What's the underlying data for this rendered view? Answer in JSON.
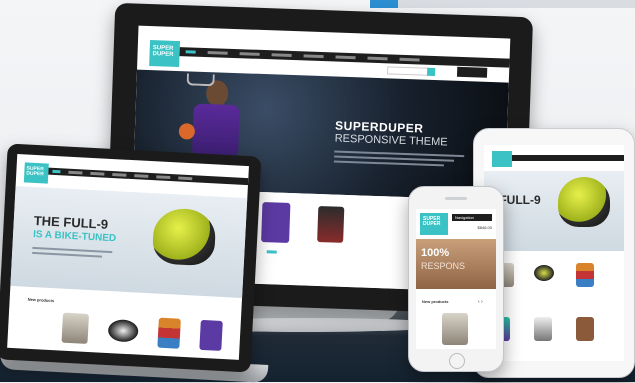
{
  "monitor": {
    "logo": [
      "SUPER",
      "DUPER"
    ],
    "headline": "SUPERDUPER",
    "subhead": "RESPONSIVE THEME"
  },
  "laptop": {
    "logo": [
      "SUPER",
      "DUPER"
    ],
    "headline": "THE FULL-9",
    "subhead": "IS A BIKE-TUNED",
    "section_title": "New products"
  },
  "tablet": {
    "headline": "E FULL-9"
  },
  "phone": {
    "logo": [
      "SUPER",
      "DUPER"
    ],
    "nav_label": "Navigation",
    "cart_amount": "$846.00",
    "headline": "100%",
    "subhead": "RESPONS",
    "section_title": "New products"
  },
  "colors": {
    "accent": "#3ac2c4",
    "bezel": "#1b1b1b",
    "navbar": "#1e1e1e"
  }
}
